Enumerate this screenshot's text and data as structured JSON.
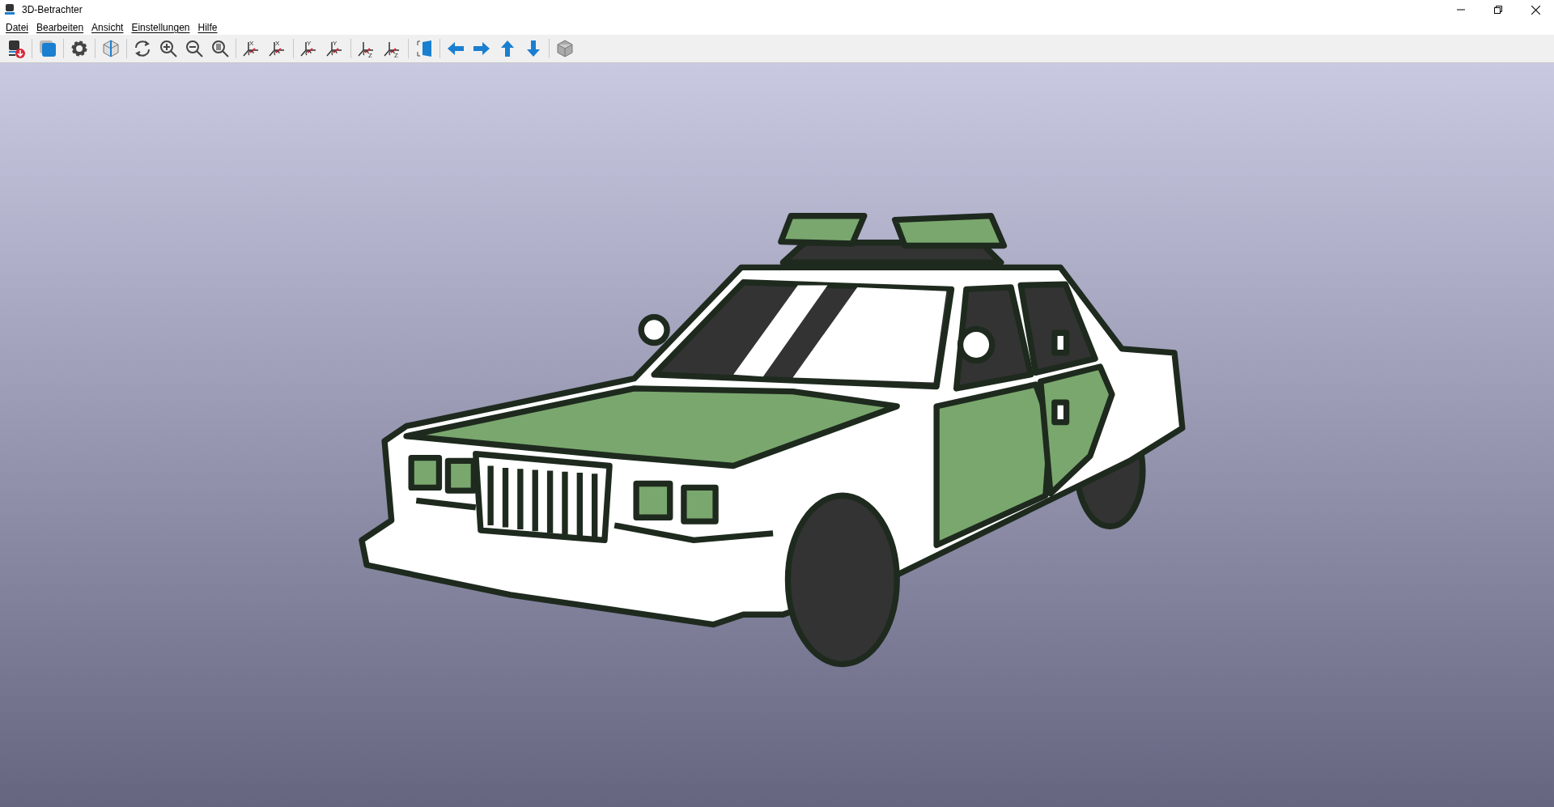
{
  "window": {
    "title": "3D-Betrachter"
  },
  "menu": [
    "Datei",
    "Bearbeiten",
    "Ansicht",
    "Einstellungen",
    "Hilfe"
  ],
  "toolbar": [
    {
      "kind": "export"
    },
    {
      "kind": "separator"
    },
    {
      "kind": "material"
    },
    {
      "kind": "separator"
    },
    {
      "kind": "settings"
    },
    {
      "kind": "separator"
    },
    {
      "kind": "box3d"
    },
    {
      "kind": "separator"
    },
    {
      "kind": "refresh"
    },
    {
      "kind": "zoom_in"
    },
    {
      "kind": "zoom_out"
    },
    {
      "kind": "zoom_fit"
    },
    {
      "kind": "separator"
    },
    {
      "kind": "rotate",
      "axis": "X"
    },
    {
      "kind": "rotate",
      "axis": "X"
    },
    {
      "kind": "separator"
    },
    {
      "kind": "rotate",
      "axis": "Y"
    },
    {
      "kind": "rotate",
      "axis": "Y"
    },
    {
      "kind": "separator"
    },
    {
      "kind": "rotate",
      "axis": "Z"
    },
    {
      "kind": "rotate",
      "axis": "Z"
    },
    {
      "kind": "separator"
    },
    {
      "kind": "flip"
    },
    {
      "kind": "separator"
    },
    {
      "kind": "left"
    },
    {
      "kind": "right"
    },
    {
      "kind": "up"
    },
    {
      "kind": "down"
    },
    {
      "kind": "separator"
    },
    {
      "kind": "cube"
    }
  ]
}
